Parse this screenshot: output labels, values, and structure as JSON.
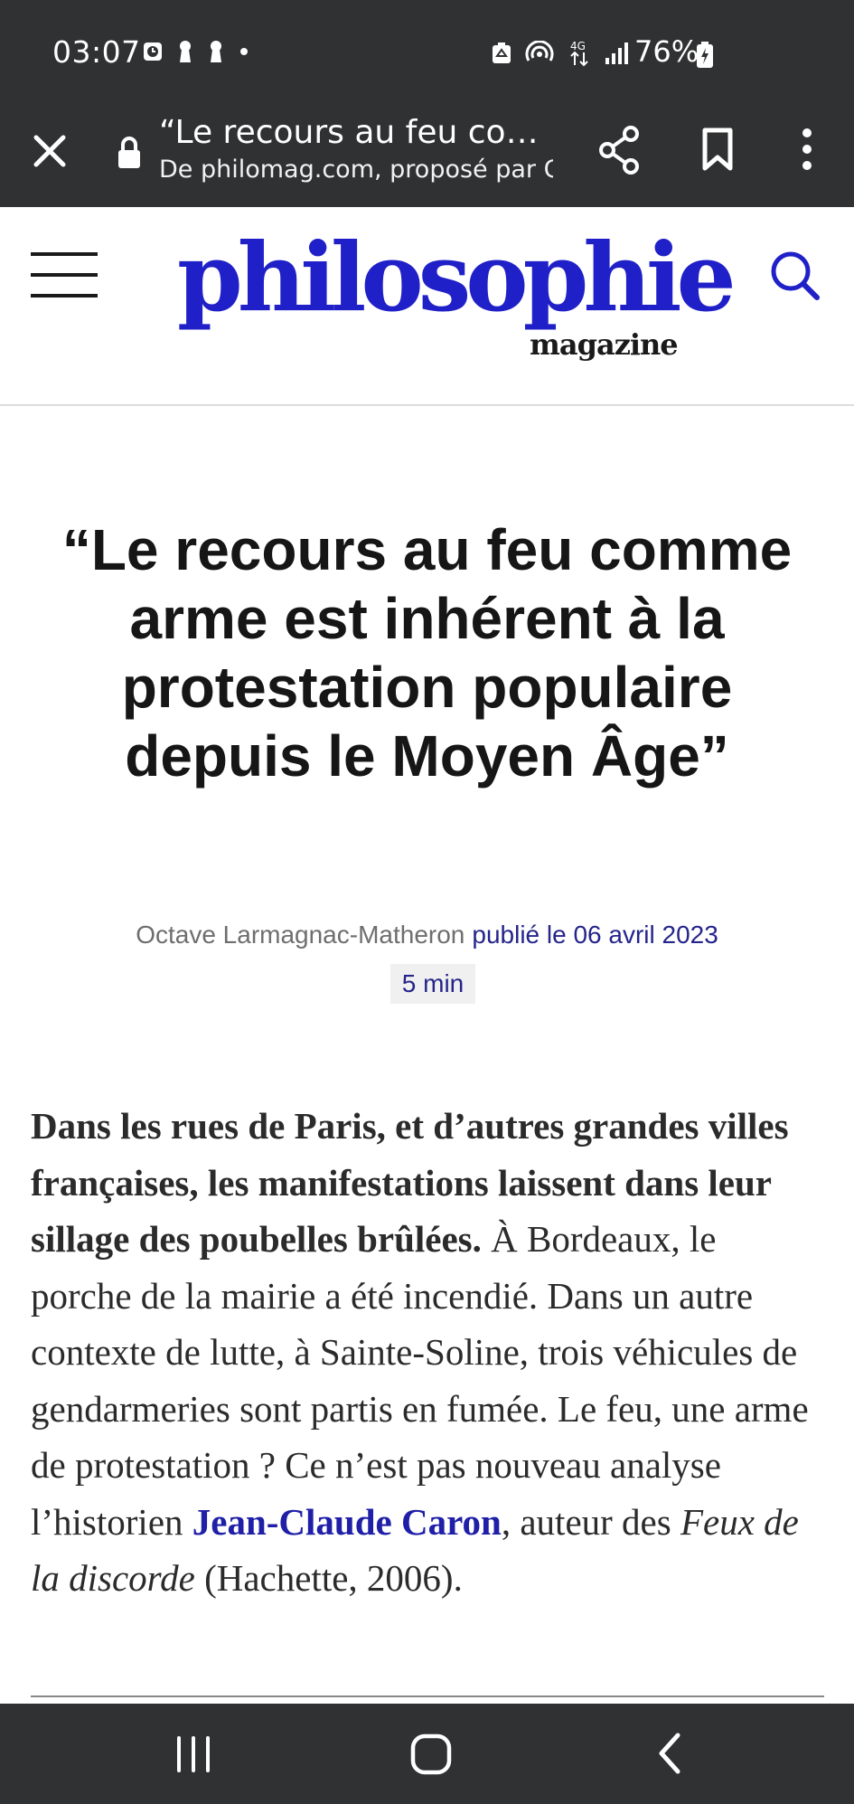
{
  "status_bar": {
    "time": "03:07",
    "battery_percent": "76%",
    "network": "4G",
    "icons_left": [
      "clock-badge-icon",
      "keyhole-icon",
      "keyhole-icon",
      "dot-icon"
    ],
    "icons_right": [
      "recycle-icon",
      "hotspot-icon",
      "data-arrows-icon",
      "signal-icon",
      "battery-charging-icon"
    ]
  },
  "browser_toolbar": {
    "page_title": "“Le recours au feu co…",
    "page_origin": "De philomag.com, proposé par Go"
  },
  "site_header": {
    "logo_main": "philosophie",
    "logo_sub": "magazine",
    "brand_color": "#2020c8"
  },
  "article": {
    "title": "“Le recours au feu comme arme est inhérent à la protestation populaire depuis le Moyen Âge”",
    "author": "Octave Larmagnac-Matheron",
    "published": "publié le 06 avril 2023",
    "read_time": "5 min",
    "lede_bold": "Dans les rues de Paris, et d’autres grandes villes françaises, les manifestations laissent dans leur sillage des poubelles brûlées.",
    "lede_text_1": " À Bordeaux, le porche de la mairie a été incendié. Dans un autre contexte de lutte, à Sainte-Soline, trois véhicules de gendarmeries sont partis en fumée. Le feu, une arme de protestation ? Ce n’est pas nouveau analyse l’historien ",
    "lede_link": "Jean-Claude Caron",
    "lede_text_2": ", auteur des ",
    "lede_italic": "Feux de la discorde",
    "lede_text_3": " (Hachette, 2006)."
  },
  "nav_bar": {
    "buttons": [
      "recent-apps",
      "home",
      "back"
    ]
  }
}
